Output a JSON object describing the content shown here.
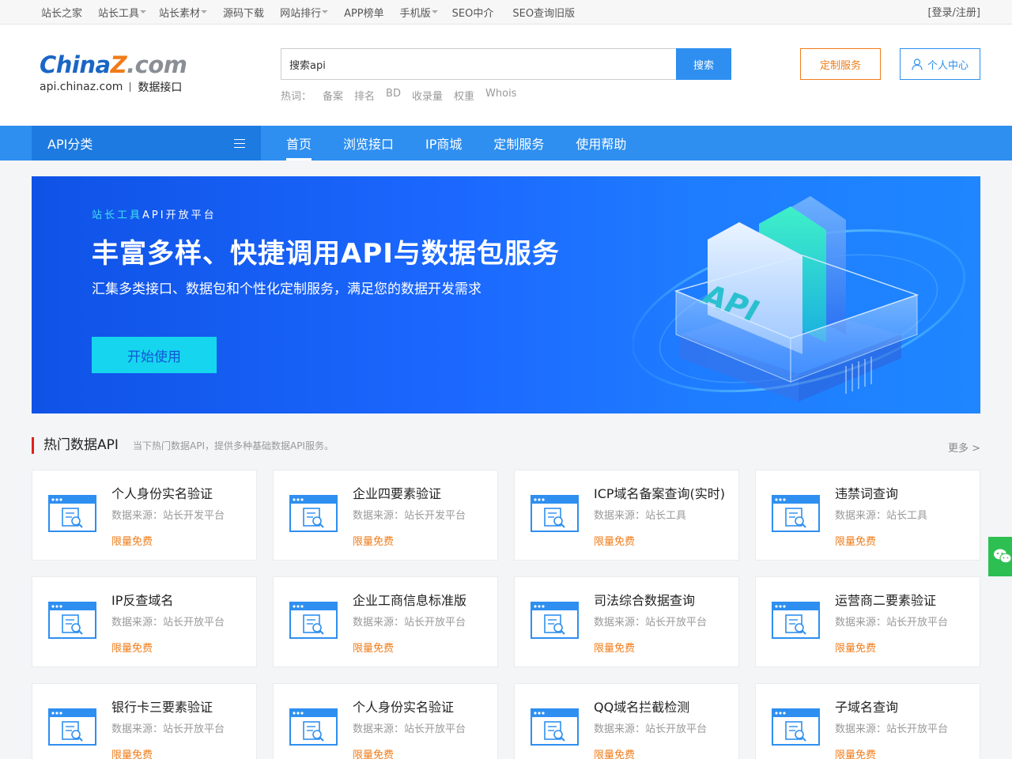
{
  "topbar": {
    "links": [
      {
        "label": "站长之家",
        "caret": false
      },
      {
        "label": "站长工具",
        "caret": true
      },
      {
        "label": "站长素材",
        "caret": true
      },
      {
        "label": "源码下载",
        "caret": false
      },
      {
        "label": "网站排行",
        "caret": true
      },
      {
        "label": "APP榜单",
        "caret": false
      },
      {
        "label": "手机版",
        "caret": true
      },
      {
        "label": "SEO中介",
        "caret": false
      },
      {
        "label": "SEO查询旧版",
        "caret": false
      }
    ],
    "login": "[登录/注册]"
  },
  "header": {
    "logo": {
      "china": "China",
      "z": "Z",
      "com": ".com",
      "domain": "api.chinaz.com",
      "tagline": "数据接口"
    },
    "search": {
      "value": "搜索api",
      "button": "搜索"
    },
    "hot": {
      "label": "热词：",
      "keywords": [
        "备案",
        "排名",
        "BD",
        "收录量",
        "权重",
        "Whois"
      ]
    },
    "custom_button": "定制服务",
    "user_button": "个人中心"
  },
  "nav": {
    "category": "API分类",
    "items": [
      "首页",
      "浏览接口",
      "IP商城",
      "定制服务",
      "使用帮助"
    ],
    "active_index": 0
  },
  "banner": {
    "kicker_highlight": "站长工具",
    "kicker_rest": "API开放平台",
    "title": "丰富多样、快捷调用API与数据包服务",
    "subtitle": "汇集多类接口、数据包和个性化定制服务，满足您的数据开发需求",
    "cta": "开始使用",
    "art_text": "API"
  },
  "section": {
    "title": "热门数据API",
    "description": "当下热门数据API，提供多种基础数据API服务。",
    "more": "更多 >"
  },
  "cards": [
    {
      "name": "个人身份实名验证",
      "source": "数据来源：站长开发平台",
      "tag": "限量免费"
    },
    {
      "name": "企业四要素验证",
      "source": "数据来源：站长开发平台",
      "tag": "限量免费"
    },
    {
      "name": "ICP域名备案查询(实时)",
      "source": "数据来源：站长工具",
      "tag": "限量免费"
    },
    {
      "name": "违禁词查询",
      "source": "数据来源：站长工具",
      "tag": "限量免费"
    },
    {
      "name": "IP反查域名",
      "source": "数据来源：站长开放平台",
      "tag": "限量免费"
    },
    {
      "name": "企业工商信息标准版",
      "source": "数据来源：站长开放平台",
      "tag": "限量免费"
    },
    {
      "name": "司法综合数据查询",
      "source": "数据来源：站长开放平台",
      "tag": "限量免费"
    },
    {
      "name": "运营商二要素验证",
      "source": "数据来源：站长开放平台",
      "tag": "限量免费"
    },
    {
      "name": "银行卡三要素验证",
      "source": "数据来源：站长开放平台",
      "tag": "限量免费"
    },
    {
      "name": "个人身份实名验证",
      "source": "数据来源：站长开放平台",
      "tag": "限量免费"
    },
    {
      "name": "QQ域名拦截检测",
      "source": "数据来源：站长开放平台",
      "tag": "限量免费"
    },
    {
      "name": "子域名查询",
      "source": "数据来源：站长开放平台",
      "tag": "限量免费"
    }
  ],
  "icons": {
    "card": "api-document-search-icon",
    "user": "user-icon",
    "menu": "menu-icon",
    "chat": "wechat-icon"
  },
  "colors": {
    "primary": "#2e8ff0",
    "accent_orange": "#f07c1a",
    "banner_cyan": "#15d6ee",
    "section_marker": "#e0201c"
  }
}
